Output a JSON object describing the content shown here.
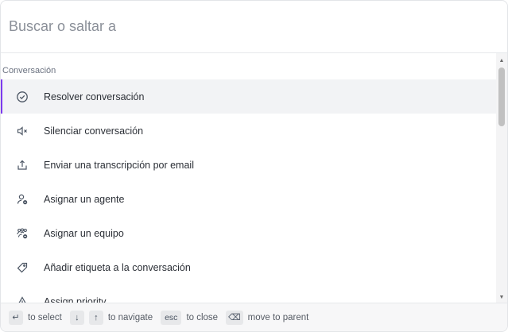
{
  "search": {
    "placeholder": "Buscar o saltar a",
    "value": ""
  },
  "section": {
    "title": "Conversación"
  },
  "items": [
    {
      "label": "Resolver conversación",
      "icon": "check-circle-icon"
    },
    {
      "label": "Silenciar conversación",
      "icon": "mute-icon"
    },
    {
      "label": "Enviar una transcripción por email",
      "icon": "share-upload-icon"
    },
    {
      "label": "Asignar un agente",
      "icon": "assign-agent-icon"
    },
    {
      "label": "Asignar un equipo",
      "icon": "assign-team-icon"
    },
    {
      "label": "Añadir etiqueta a la conversación",
      "icon": "tag-icon"
    },
    {
      "label": "Assign priority",
      "icon": "warning-icon"
    }
  ],
  "footer": {
    "select_key": "↵",
    "select_label": "to select",
    "down_key": "↓",
    "up_key": "↑",
    "navigate_label": "to navigate",
    "esc_key": "esc",
    "close_label": "to close",
    "back_key": "⌫",
    "parent_label": "move to parent"
  },
  "colors": {
    "accent": "#7c3aed",
    "active_bg": "#f2f3f5",
    "footer_bg": "#f7f7f8"
  }
}
